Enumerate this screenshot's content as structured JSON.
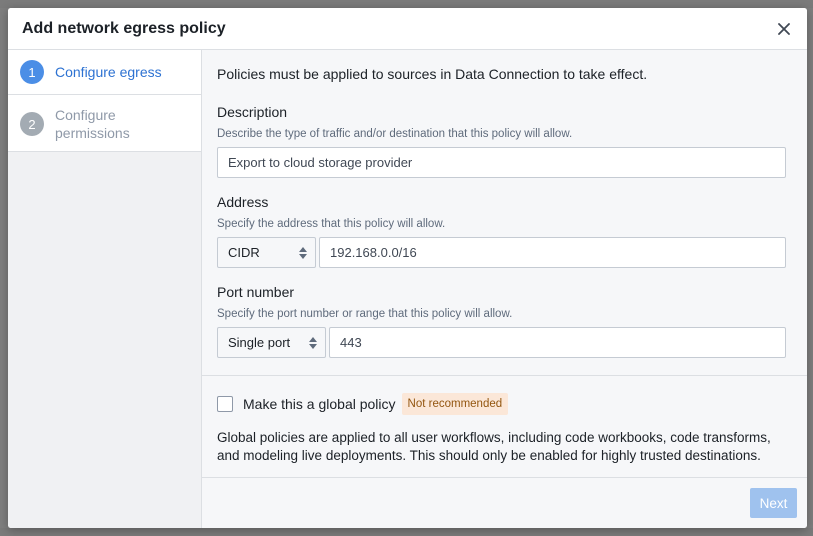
{
  "dialog": {
    "title": "Add network egress policy"
  },
  "steps": [
    {
      "number": "1",
      "label": "Configure egress"
    },
    {
      "number": "2",
      "label": "Configure permissions"
    }
  ],
  "form": {
    "intro": "Policies must be applied to sources in Data Connection to take effect.",
    "description": {
      "label": "Description",
      "helper": "Describe the type of traffic and/or destination that this policy will allow.",
      "value": "Export to cloud storage provider"
    },
    "address": {
      "label": "Address",
      "helper": "Specify the address that this policy will allow.",
      "type_selected": "CIDR",
      "value": "192.168.0.0/16"
    },
    "port": {
      "label": "Port number",
      "helper": "Specify the port number or range that this policy will allow.",
      "type_selected": "Single port",
      "value": "443"
    }
  },
  "global_policy": {
    "checkbox_label": "Make this a global policy",
    "checked": false,
    "badge": "Not recommended",
    "description": "Global policies are applied to all user workflows, including code workbooks, code transforms, and modeling live deployments. This should only be enabled for highly trusted destinations."
  },
  "footer": {
    "next_label": "Next"
  },
  "icons": {
    "close": "close-icon",
    "select_caret": "double-caret-icon"
  },
  "colors": {
    "accent": "#2d72d2",
    "step_active": "#4b8ee6",
    "step_inactive": "#a3abb3",
    "next_disabled": "#9fc2ee",
    "badge_bg": "#fbe7d8",
    "badge_text": "#935610"
  }
}
